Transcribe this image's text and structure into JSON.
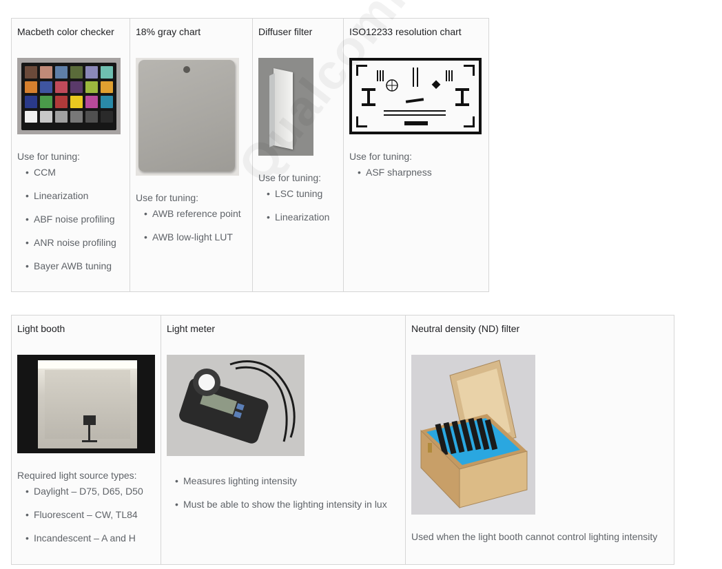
{
  "row1": [
    {
      "title": "Macbeth color checker",
      "label": "Use for tuning:",
      "items": [
        "CCM",
        "Linearization",
        "ABF noise profiling",
        "ANR noise profiling",
        "Bayer AWB tuning"
      ],
      "photo": "color-checker-chart"
    },
    {
      "title": "18% gray chart",
      "label": "Use for tuning:",
      "items": [
        "AWB reference point",
        "AWB low-light LUT"
      ],
      "photo": "gray-card"
    },
    {
      "title": "Diffuser filter",
      "label": "Use for tuning:",
      "items": [
        "LSC tuning",
        "Linearization"
      ],
      "photo": "diffuser-glass"
    },
    {
      "title": "ISO12233 resolution chart",
      "label": "Use for tuning:",
      "items": [
        "ASF sharpness"
      ],
      "photo": "resolution-chart"
    }
  ],
  "row2": [
    {
      "title": "Light booth",
      "label": "Required light source types:",
      "items": [
        "Daylight – D75, D65, D50",
        "Fluorescent – CW, TL84",
        "Incandescent – A and H"
      ],
      "photo": "light-booth"
    },
    {
      "title": "Light meter",
      "items": [
        "Measures lighting intensity",
        "Must be able to show the lighting intensity in lux"
      ],
      "photo": "light-meter"
    },
    {
      "title": "Neutral density (ND) filter",
      "note": "Used when the light booth cannot control lighting intensity",
      "photo": "nd-filter-box"
    }
  ],
  "checker_colors": [
    "#6b4a3a",
    "#c08a78",
    "#5f7fa8",
    "#5a6b3a",
    "#8b88b8",
    "#6fbfb0",
    "#d6802e",
    "#3f55a0",
    "#c04a5a",
    "#5a3a6a",
    "#9cb83e",
    "#e0a030",
    "#2a3a8a",
    "#4a9a4a",
    "#b03a3a",
    "#e8c820",
    "#b84a9a",
    "#2a8aa8",
    "#f0f0f0",
    "#c8c8c8",
    "#a0a0a0",
    "#787878",
    "#505050",
    "#2a2a2a"
  ]
}
